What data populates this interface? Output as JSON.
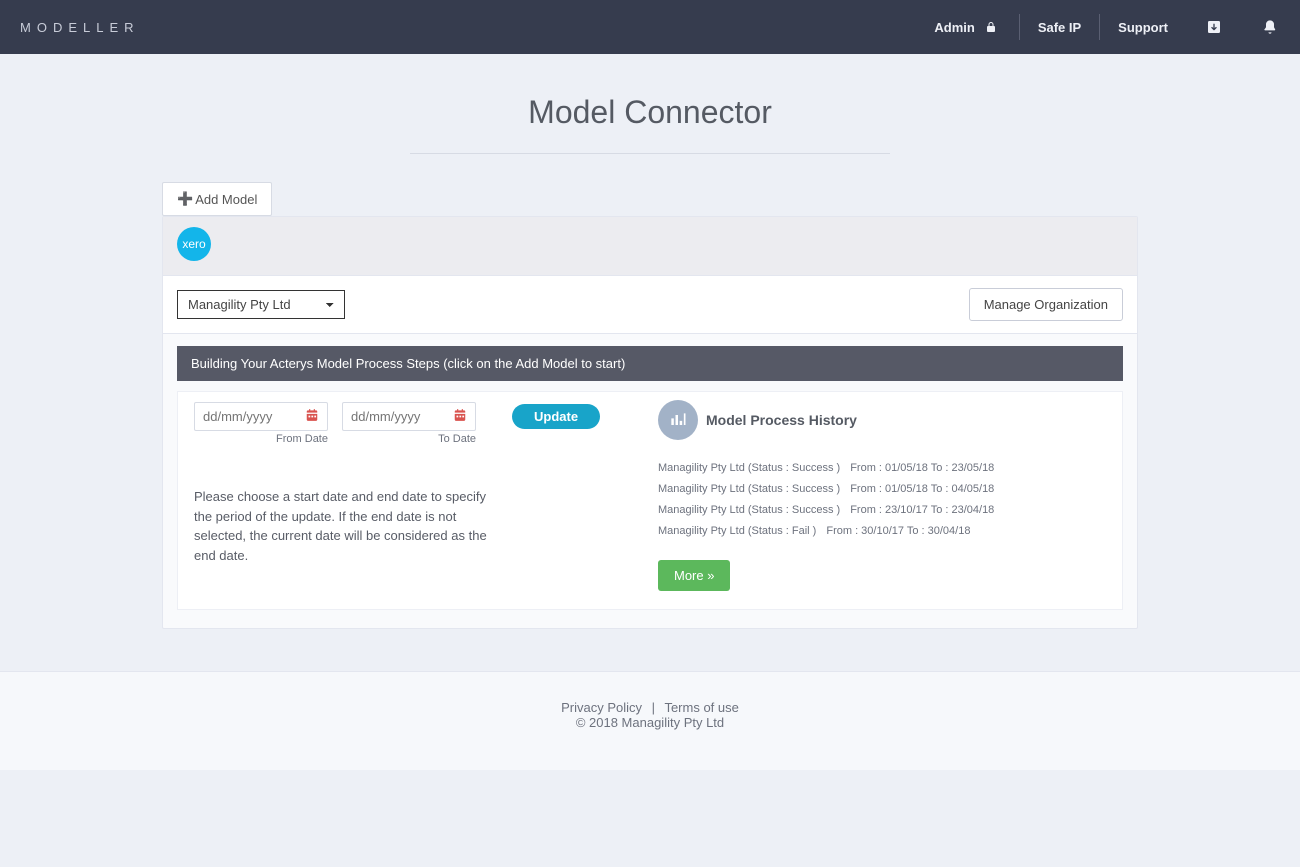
{
  "brand": "MODELLER",
  "nav": {
    "admin": "Admin",
    "safe_ip": "Safe IP",
    "support": "Support"
  },
  "page_title": "Model Connector",
  "add_model_label": "Add Model",
  "provider_badge": "xero",
  "org_select_value": "Managility Pty Ltd",
  "manage_org_label": "Manage Organization",
  "steps_bar": "Building Your Acterys Model Process Steps (click on the Add Model to start)",
  "date_placeholder": "dd/mm/yyyy",
  "from_label": "From Date",
  "to_label": "To Date",
  "update_label": "Update",
  "help_text": "Please choose a start date and end date to specify the period of the update. If the end date is not selected, the current date will be considered as the end date.",
  "history_title": "Model Process History",
  "history": [
    {
      "org": "Managility Pty Ltd",
      "status": "Success",
      "from": "01/05/18",
      "to": "23/05/18"
    },
    {
      "org": "Managility Pty Ltd",
      "status": "Success",
      "from": "01/05/18",
      "to": "04/05/18"
    },
    {
      "org": "Managility Pty Ltd",
      "status": "Success",
      "from": "23/10/17",
      "to": "23/04/18"
    },
    {
      "org": "Managility Pty Ltd",
      "status": "Fail",
      "from": "30/10/17",
      "to": "30/04/18"
    }
  ],
  "more_label": "More »",
  "footer": {
    "privacy": "Privacy Policy",
    "terms": "Terms of use",
    "copyright": "© 2018 Managility Pty Ltd"
  }
}
